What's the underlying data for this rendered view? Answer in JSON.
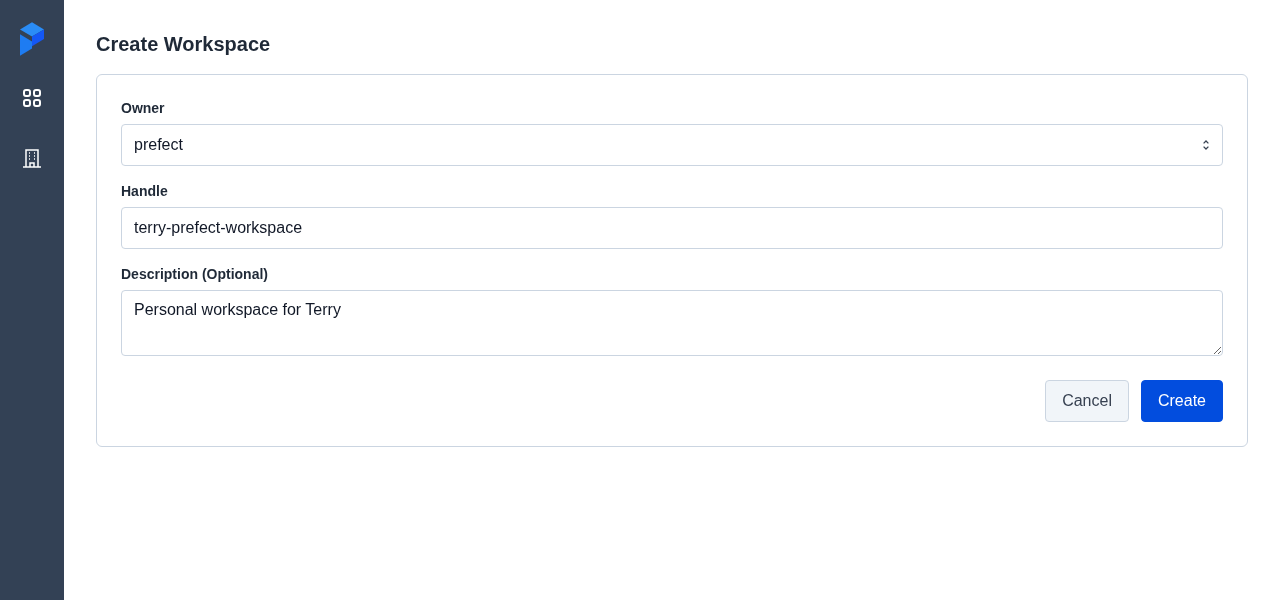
{
  "page": {
    "title": "Create Workspace"
  },
  "fields": [
    {
      "kind": "select",
      "label": "Owner",
      "value": "prefect"
    },
    {
      "kind": "text",
      "label": "Handle",
      "value": "terry-prefect-workspace"
    },
    {
      "kind": "textarea",
      "label": "Description (Optional)",
      "value": "Personal workspace for Terry"
    }
  ],
  "buttons": [
    {
      "kind": "secondary",
      "label": "Cancel"
    },
    {
      "kind": "primary",
      "label": "Create"
    }
  ]
}
